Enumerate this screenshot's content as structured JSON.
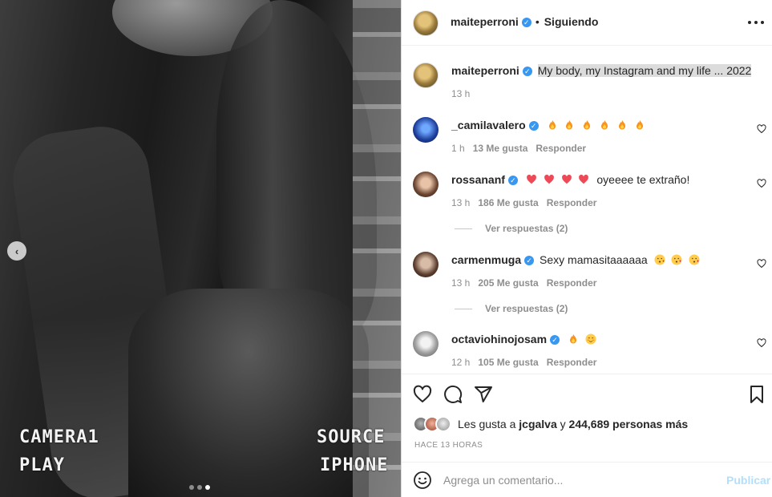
{
  "media": {
    "overlay_top_left": "CAMERA1",
    "overlay_bottom_left": "PLAY",
    "overlay_top_right": "SOURCE",
    "overlay_bottom_right": "IPHONE",
    "carousel_dots": 3,
    "active_dot": 3
  },
  "header": {
    "username": "maiteperroni",
    "separator": "•",
    "follow_status": "Siguiendo"
  },
  "caption": {
    "username": "maiteperroni",
    "text": "My body, my Instagram and my life ... 2022",
    "time": "13 h"
  },
  "comments": [
    {
      "username": "_camilavalero",
      "verified": true,
      "text": "",
      "emoji": [
        "fire",
        "fire",
        "fire",
        "fire",
        "fire",
        "fire"
      ],
      "time": "1 h",
      "likes": "13 Me gusta",
      "reply": "Responder",
      "avatar": "av-camila"
    },
    {
      "username": "rossananf",
      "verified": true,
      "text": "oyeeee te extraño!",
      "emoji": [
        "heart",
        "heart",
        "heart",
        "heart"
      ],
      "time": "13 h",
      "likes": "186 Me gusta",
      "reply": "Responder",
      "view_replies": "Ver respuestas (2)",
      "avatar": "av-rossana"
    },
    {
      "username": "carmenmuga",
      "verified": true,
      "text": "Sexy mamasitaaaaaa",
      "emoji": [
        "kiss",
        "kiss",
        "kiss"
      ],
      "time": "13 h",
      "likes": "205 Me gusta",
      "reply": "Responder",
      "view_replies": "Ver respuestas (2)",
      "avatar": "av-carmen"
    },
    {
      "username": "octaviohinojosam",
      "verified": true,
      "text": "",
      "emoji": [
        "fire",
        "blush"
      ],
      "time": "12 h",
      "likes": "105 Me gusta",
      "reply": "Responder",
      "avatar": "av-octavio"
    }
  ],
  "likes": {
    "prefix": "Les gusta a",
    "user": "jcgalva",
    "connector": "y",
    "count": "244,689 personas más"
  },
  "posted": "HACE 13 HORAS",
  "composer": {
    "placeholder": "Agrega un comentario...",
    "publish": "Publicar"
  },
  "colors": {
    "verified": "#3897f0",
    "publish_disabled": "#b2dffc",
    "heart_red": "#ed4956"
  }
}
